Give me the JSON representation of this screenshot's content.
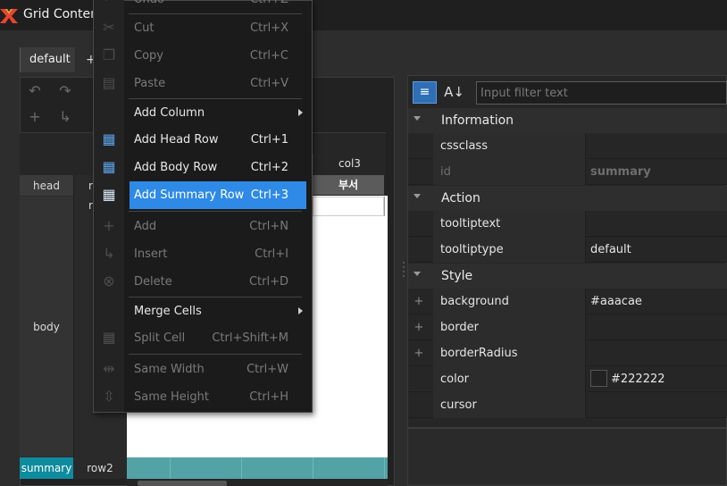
{
  "window": {
    "title": "Grid Contents Editor"
  },
  "tabs": {
    "default_label": "default",
    "add_label": "+"
  },
  "grid": {
    "col3_label": "col3",
    "head_cell_text": "부서",
    "left_labels": {
      "head": "head",
      "body": "body",
      "summary": "summary"
    },
    "row_labels": {
      "head_r": "r",
      "body_r": "r",
      "summary_row": "row2"
    },
    "colors": {
      "summary_accent": "#0e8b9e",
      "summary_band": "#53a3a6"
    }
  },
  "context_menu": {
    "items": [
      {
        "label": "Undo",
        "shortcut": "Ctrl+Z",
        "enabled": false
      },
      {
        "label": "Cut",
        "underline_index": 2,
        "shortcut": "Ctrl+X",
        "enabled": false,
        "icon": "scissors-icon"
      },
      {
        "label": "Copy",
        "shortcut": "Ctrl+C",
        "enabled": false,
        "icon": "copy-icon"
      },
      {
        "label": "Paste",
        "shortcut": "Ctrl+V",
        "enabled": false,
        "icon": "paste-icon"
      },
      {
        "label": "Add Column",
        "shortcut": "",
        "enabled": true,
        "submenu": true
      },
      {
        "label": "Add Head Row",
        "shortcut": "Ctrl+1",
        "enabled": true,
        "icon": "grid-head-icon"
      },
      {
        "label": "Add Body Row",
        "shortcut": "Ctrl+2",
        "enabled": true,
        "icon": "grid-body-icon"
      },
      {
        "label": "Add Summary Row",
        "shortcut": "Ctrl+3",
        "enabled": true,
        "highlighted": true,
        "icon": "grid-summary-icon"
      },
      {
        "label": "Add",
        "shortcut": "Ctrl+N",
        "enabled": false,
        "icon": "plus-icon"
      },
      {
        "label": "Insert",
        "shortcut": "Ctrl+I",
        "enabled": false,
        "icon": "insert-arrow-icon"
      },
      {
        "label": "Delete",
        "shortcut": "Ctrl+D",
        "enabled": false,
        "icon": "delete-icon"
      },
      {
        "label": "Merge Cells",
        "shortcut": "",
        "enabled": true,
        "submenu": true
      },
      {
        "label": "Split Cell",
        "shortcut": "Ctrl+Shift+M",
        "enabled": false,
        "icon": "split-cell-icon"
      },
      {
        "label": "Same Width",
        "shortcut": "Ctrl+W",
        "enabled": false,
        "icon": "same-width-icon"
      },
      {
        "label": "Same Height",
        "shortcut": "Ctrl+H",
        "enabled": false,
        "icon": "same-height-icon"
      }
    ],
    "colors": {
      "highlight": "#2e8ae6"
    }
  },
  "properties": {
    "filter_placeholder": "Input filter text",
    "categories": {
      "information": "Information",
      "action": "Action",
      "style": "Style"
    },
    "rows": {
      "cssclass": {
        "name": "cssclass",
        "value": ""
      },
      "id": {
        "name": "id",
        "value": "summary"
      },
      "tooltiptext": {
        "name": "tooltiptext",
        "value": ""
      },
      "tooltiptype": {
        "name": "tooltiptype",
        "value": "default"
      },
      "background": {
        "name": "background",
        "value": "#aaacae"
      },
      "border": {
        "name": "border",
        "value": ""
      },
      "borderRadius": {
        "name": "borderRadius",
        "value": ""
      },
      "color": {
        "name": "color",
        "value": "#222222"
      },
      "cursor": {
        "name": "cursor",
        "value": ""
      }
    }
  }
}
